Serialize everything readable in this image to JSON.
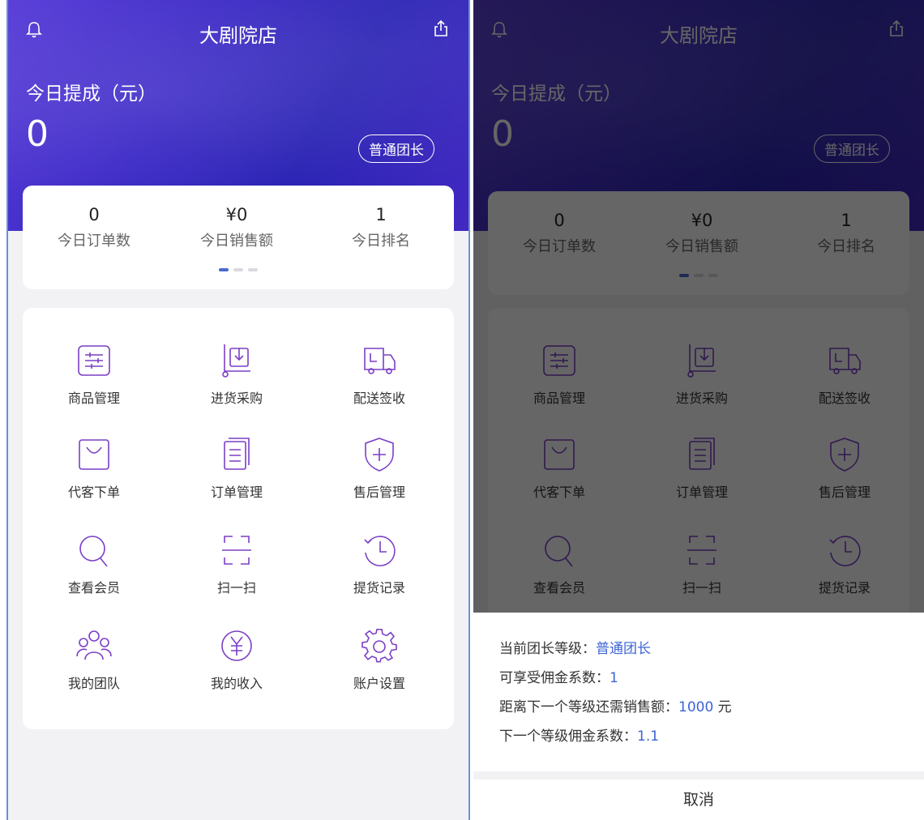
{
  "header": {
    "title": "大剧院店",
    "today_label": "今日提成（元）",
    "today_value": "0",
    "level_badge": "普通团长"
  },
  "stats": [
    {
      "value": "0",
      "label": "今日订单数"
    },
    {
      "value": "¥0",
      "label": "今日销售额"
    },
    {
      "value": "1",
      "label": "今日排名"
    }
  ],
  "pager": {
    "pages": 3,
    "active": 1
  },
  "menu": [
    {
      "label": "商品管理",
      "icon": "goods-list-icon"
    },
    {
      "label": "进货采购",
      "icon": "purchase-cart-icon"
    },
    {
      "label": "配送签收",
      "icon": "delivery-truck-icon"
    },
    {
      "label": "代客下单",
      "icon": "shopping-bag-icon"
    },
    {
      "label": "订单管理",
      "icon": "order-document-icon"
    },
    {
      "label": "售后管理",
      "icon": "shield-plus-icon"
    },
    {
      "label": "查看会员",
      "icon": "magnifier-icon"
    },
    {
      "label": "扫一扫",
      "icon": "scan-icon"
    },
    {
      "label": "提货记录",
      "icon": "clock-history-icon"
    },
    {
      "label": "我的团队",
      "icon": "team-icon"
    },
    {
      "label": "我的收入",
      "icon": "yuan-coin-icon"
    },
    {
      "label": "账户设置",
      "icon": "gear-icon"
    }
  ],
  "sheet": {
    "current_level_label": "当前团长等级：",
    "current_level_value": "普通团长",
    "coefficient_label": "可享受佣金系数：",
    "coefficient_value": "1",
    "next_sales_label": "距离下一个等级还需销售额：",
    "next_sales_value": "1000",
    "next_sales_unit": " 元",
    "next_coefficient_label": "下一个等级佣金系数：",
    "next_coefficient_value": "1.1",
    "cancel": "取消"
  },
  "colors": {
    "header_gradient": [
      "#5a3fd8",
      "#2a23b4"
    ],
    "icon_stroke": "#7b3fc6",
    "accent": "#3d64d8"
  }
}
